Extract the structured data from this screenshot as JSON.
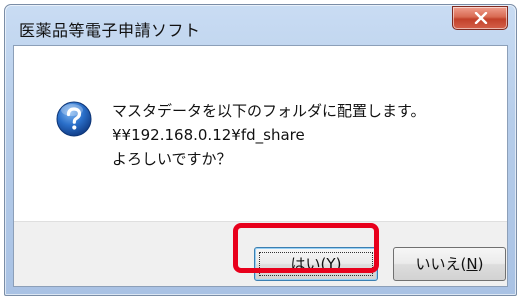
{
  "window": {
    "title": "医薬品等電子申請ソフト"
  },
  "message": {
    "line1": "マスタデータを以下のフォルダに配置します。",
    "line2": "¥¥192.168.0.12¥fd_share",
    "line3": "よろしいですか？"
  },
  "buttons": {
    "yes_prefix": "はい(",
    "yes_key": "Y",
    "yes_suffix": ")",
    "no_prefix": "いいえ(",
    "no_key": "N",
    "no_suffix": ")"
  },
  "icons": {
    "dialog": "question-icon",
    "close": "close-icon"
  },
  "colors": {
    "highlight": "#e8001c",
    "close_button": "#c2412a",
    "title_bar": "#b6cdea"
  }
}
